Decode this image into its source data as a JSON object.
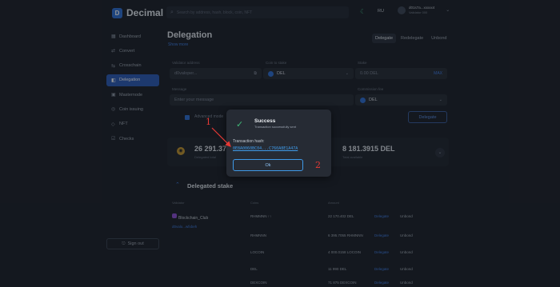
{
  "header": {
    "logo_text": "Decimal",
    "search_placeholder": "Search by address, hash, block, coin, NFT",
    "language": "RU",
    "account_address": "d01s7a...xxxxx4",
    "account_sub": "Validator 000"
  },
  "sidebar": {
    "items": [
      {
        "label": "Dashboard",
        "icon": "grid-icon"
      },
      {
        "label": "Convert",
        "icon": "convert-icon"
      },
      {
        "label": "Crosschain",
        "icon": "crosschain-icon"
      },
      {
        "label": "Delegation",
        "icon": "delegation-icon"
      },
      {
        "label": "Masternode",
        "icon": "masternode-icon"
      },
      {
        "label": "Coin issuing",
        "icon": "coin-icon"
      },
      {
        "label": "NFT",
        "icon": "nft-icon"
      },
      {
        "label": "Checks",
        "icon": "check-icon"
      }
    ],
    "active_index": 3,
    "sign_out": "Sign out"
  },
  "main": {
    "title": "Delegation",
    "show_more": "Show more",
    "tabs": [
      "Delegate",
      "Redelegate",
      "Unbond"
    ],
    "active_tab": 0,
    "form": {
      "validator_label": "Validator address",
      "validator_value": "d0valoper...",
      "coin_label": "Coin to stake",
      "coin_value": "DEL",
      "stake_label": "Stake",
      "stake_placeholder": "0.00 DEL",
      "max_label": "MAX",
      "message_label": "Message",
      "message_placeholder": "Enter your message",
      "commission_label": "Commission fee",
      "commission_value": "DEL",
      "checkbox_label": "Advanced mode",
      "delegate_button": "Delegate"
    },
    "stats": {
      "delegated": "26 291.376",
      "delegated_label": "Delegated total",
      "available": "8 181.3915 DEL",
      "available_label": "Total available"
    },
    "stake": {
      "title": "Delegated stake",
      "headers": [
        "Validator",
        "Coins",
        "Amount"
      ],
      "validator_name": "Blockchain_Club",
      "validator_addr": "d0valo...wfxbeh",
      "rows": [
        {
          "coin": "RHMMNN ↑↑",
          "amount": "22 170.402 DEL",
          "a1": "Delegate",
          "a2": "Unbond"
        },
        {
          "coin": "RHMNNN",
          "amount": "6 395.7055 RHMNNN",
          "a1": "Delegate",
          "a2": "Unbond"
        },
        {
          "coin": "LOCOIN",
          "amount": "4 000.0158 LOCOIN",
          "a1": "Delegate",
          "a2": "Unbond"
        },
        {
          "coin": "DEL",
          "amount": "11 990 DEL",
          "a1": "Delegate",
          "a2": "Unbond"
        },
        {
          "coin": "DEXCOIN",
          "amount": "71 875 DEXCOIN",
          "a1": "Delegate",
          "a2": "Unbond"
        }
      ]
    }
  },
  "modal": {
    "title": "Success",
    "subtitle": "Transaction successfully sent",
    "hash_label": "Transaction hash:",
    "hash_value": "0E8A0060BC04...C760A8E1A47A",
    "ok_button": "Ok"
  },
  "annotations": {
    "one": "1",
    "two": "2",
    "color": "#e53935"
  }
}
